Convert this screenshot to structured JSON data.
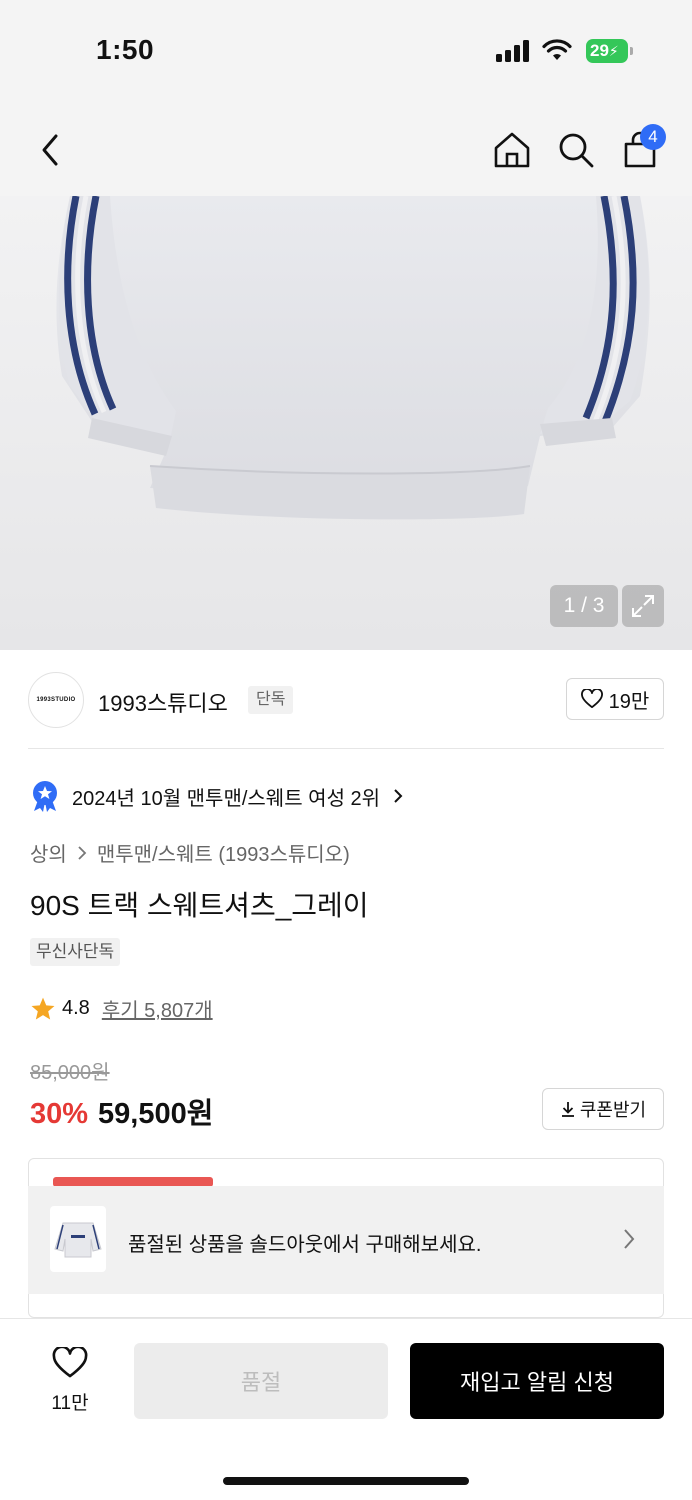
{
  "status_bar": {
    "time": "1:50",
    "battery": "29"
  },
  "header": {
    "cart_count": "4",
    "icons": [
      "back-icon",
      "home-icon",
      "search-icon",
      "cart-icon"
    ]
  },
  "gallery": {
    "pager": "1 / 3"
  },
  "brand": {
    "logo_text": "1993STUDIO",
    "name": "1993스튜디오",
    "tag": "단독",
    "likes": "19만"
  },
  "ranking": {
    "text": "2024년 10월 맨투맨/스웨트 여성 2위"
  },
  "breadcrumb": {
    "category": "상의",
    "subcategory": "맨투맨/스웨트 (1993스튜디오)"
  },
  "product": {
    "title": "90S 트랙 스웨트셔츠_그레이",
    "exclusive_tag": "무신사단독",
    "rating": "4.8",
    "reviews": "후기 5,807개",
    "original_price": "85,000원",
    "discount": "30%",
    "price": "59,500원",
    "coupon_label": "쿠폰받기"
  },
  "soldout_banner": {
    "text": "품절된 상품을 솔드아웃에서 구매해보세요."
  },
  "bottom_bar": {
    "wish_count": "11만",
    "soldout_label": "품절",
    "restock_label": "재입고 알림 신청"
  },
  "colors": {
    "accent_red": "#e53935",
    "badge_blue": "#2f6cf6",
    "battery_green": "#34c759",
    "stripe_navy": "#2c3f78"
  }
}
